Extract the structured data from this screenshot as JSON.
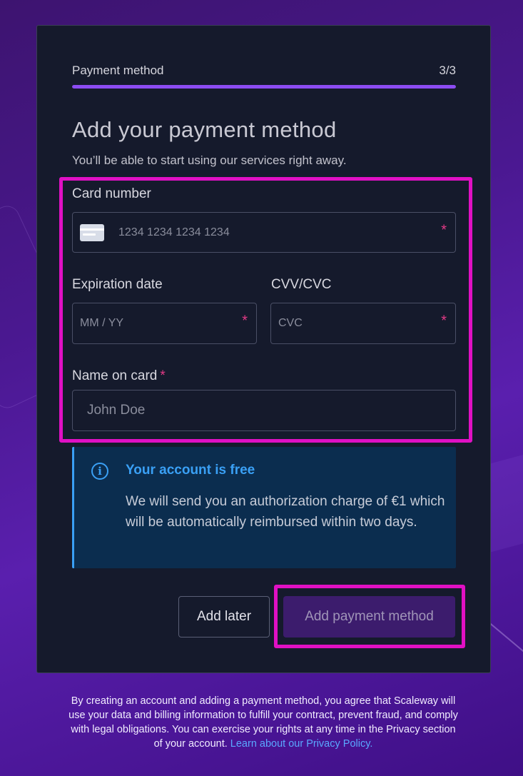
{
  "stepper": {
    "label": "Payment method",
    "count": "3/3",
    "progress": 1.0
  },
  "heading": {
    "title": "Add your payment method",
    "subtitle": "You’ll be able to start using our services right away."
  },
  "form": {
    "card_number": {
      "label": "Card number",
      "placeholder": "1234 1234 1234 1234",
      "required_mark": "*",
      "icon": "credit-card-icon"
    },
    "expiration": {
      "label": "Expiration date",
      "placeholder": "MM / YY",
      "required_mark": "*"
    },
    "cvc": {
      "label": "CVV/CVC",
      "placeholder": "CVC",
      "required_mark": "*"
    },
    "name": {
      "label": "Name on card",
      "required_mark": "*",
      "placeholder": "John Doe"
    }
  },
  "info": {
    "icon": "info-icon",
    "title": "Your account is free",
    "text": "We will send you an authorization charge of €1 which will be automatically reimbursed within two days."
  },
  "actions": {
    "secondary": "Add later",
    "primary": "Add payment method"
  },
  "footer": {
    "text": "By creating an account and adding a payment method, you agree that Scaleway will use your data and billing information to fulfill your contract, prevent fraud, and comply with legal obligations. You can exercise your rights at any time in the Privacy section of your account.",
    "link": "Learn about our Privacy Policy."
  },
  "colors": {
    "accent": "#8c4cf2",
    "required": "#e33a86",
    "info": "#3aa0f5",
    "highlight": "#e010c4"
  }
}
